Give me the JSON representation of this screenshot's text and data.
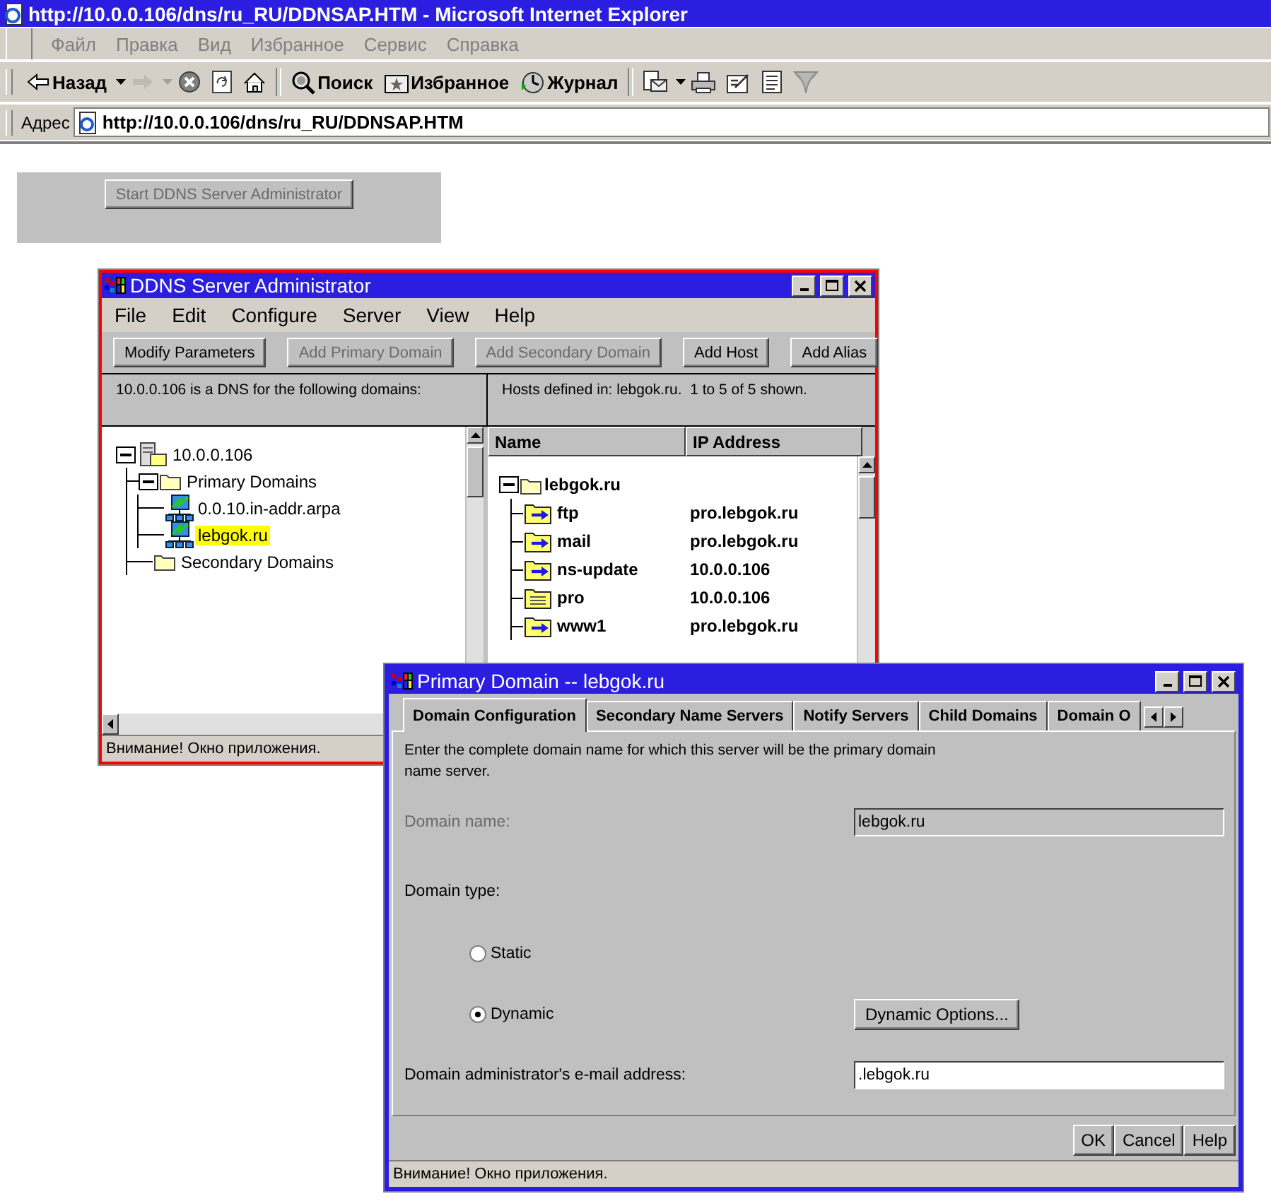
{
  "browser": {
    "title": "http://10.0.0.106/dns/ru_RU/DDNSAP.HTM - Microsoft Internet Explorer",
    "menu": [
      "Файл",
      "Правка",
      "Вид",
      "Избранное",
      "Сервис",
      "Справка"
    ],
    "toolbar": [
      {
        "kind": "back",
        "label": "Назад",
        "dropdown": true,
        "disabled": false
      },
      {
        "kind": "forward",
        "dropdown": true,
        "disabled": true
      },
      {
        "kind": "stop",
        "dropdown": false,
        "disabled": false
      },
      {
        "kind": "refresh",
        "dropdown": false,
        "disabled": false
      },
      {
        "kind": "home",
        "dropdown": false,
        "disabled": false
      },
      {
        "kind": "search",
        "label": "Поиск",
        "dropdown": false,
        "disabled": false
      },
      {
        "kind": "favorites",
        "label": "Избранное",
        "dropdown": false,
        "disabled": false
      },
      {
        "kind": "history",
        "label": "Журнал",
        "dropdown": false,
        "disabled": false
      },
      {
        "kind": "mail",
        "dropdown": true,
        "disabled": false
      },
      {
        "kind": "print",
        "dropdown": false,
        "disabled": false
      },
      {
        "kind": "edit",
        "dropdown": false,
        "disabled": false
      },
      {
        "kind": "discuss",
        "dropdown": false,
        "disabled": false
      },
      {
        "kind": "messenger",
        "dropdown": false,
        "disabled": false
      }
    ],
    "address_label": "Адрес",
    "address": "http://10.0.0.106/dns/ru_RU/DDNSAP.HTM"
  },
  "page": {
    "start_button": {
      "label": "Start DDNS Server Administrator",
      "disabled": true
    }
  },
  "admin_window": {
    "title": "DDNS Server Administrator",
    "menu": [
      "File",
      "Edit",
      "Configure",
      "Server",
      "View",
      "Help"
    ],
    "buttons": [
      {
        "label": "Modify Parameters",
        "disabled": false
      },
      {
        "label": "Add Primary Domain",
        "disabled": true
      },
      {
        "label": "Add Secondary Domain",
        "disabled": true
      },
      {
        "label": "Add Host",
        "disabled": false
      },
      {
        "label": "Add Alias",
        "disabled": false
      }
    ],
    "left_header": "10.0.0.106 is a DNS for the following domains:",
    "right_header": "Hosts defined in: lebgok.ru.  1 to 5 of 5 shown.",
    "tree": [
      {
        "label": "10.0.0.106",
        "kind": "server",
        "expanded": true,
        "selected": false,
        "children": [
          {
            "label": "Primary Domains",
            "kind": "folder",
            "expanded": true,
            "selected": false,
            "children": [
              {
                "label": "0.0.10.in-addr.arpa",
                "kind": "zone",
                "selected": false
              },
              {
                "label": "lebgok.ru",
                "kind": "zone",
                "selected": true
              }
            ]
          },
          {
            "label": "Secondary Domains",
            "kind": "folder",
            "selected": false
          }
        ]
      }
    ],
    "table": {
      "columns": [
        "Name",
        "IP Address"
      ],
      "group": {
        "label": "lebgok.ru",
        "expanded": true
      },
      "rows": [
        {
          "name": "ftp",
          "ip": "pro.lebgok.ru",
          "kind": "alias"
        },
        {
          "name": "mail",
          "ip": "pro.lebgok.ru",
          "kind": "alias"
        },
        {
          "name": "ns-update",
          "ip": "10.0.0.106",
          "kind": "alias"
        },
        {
          "name": "pro",
          "ip": "10.0.0.106",
          "kind": "host"
        },
        {
          "name": "www1",
          "ip": "pro.lebgok.ru",
          "kind": "alias"
        }
      ]
    },
    "status": "Внимание! Окно приложения."
  },
  "dialog": {
    "title": "Primary Domain -- lebgok.ru",
    "tabs": [
      {
        "label": "Domain Configuration",
        "selected": true
      },
      {
        "label": "Secondary Name Servers",
        "selected": false
      },
      {
        "label": "Notify Servers",
        "selected": false
      },
      {
        "label": "Child Domains",
        "selected": false
      },
      {
        "label": "Domain O",
        "selected": false
      }
    ],
    "intro": "Enter the complete domain name for which this server will be the primary domain name server.",
    "domain_name": {
      "label": "Domain name:",
      "value": "lebgok.ru",
      "disabled": true
    },
    "domain_type_label": "Domain type:",
    "radios": [
      {
        "label": "Static",
        "selected": false
      },
      {
        "label": "Dynamic",
        "selected": true
      }
    ],
    "dynamic_options_button": "Dynamic Options...",
    "email": {
      "label": "Domain administrator's e-mail address:",
      "value": ".lebgok.ru",
      "disabled": false
    },
    "buttons": [
      "OK",
      "Cancel",
      "Help"
    ],
    "status": "Внимание! Окно приложения."
  }
}
